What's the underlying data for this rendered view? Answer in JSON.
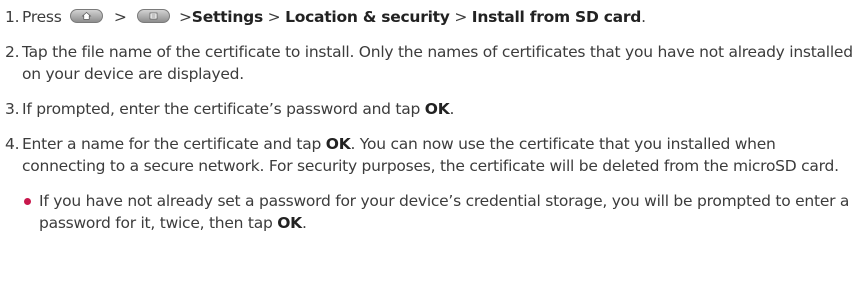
{
  "steps": [
    {
      "number": "1.",
      "press": "Press",
      "sep1": ">",
      "sep2": ">",
      "settings": "Settings",
      "sep3": ">",
      "location": "Location & security",
      "sep4": ">",
      "install": "Install from SD card",
      "end": "."
    },
    {
      "number": "2.",
      "text": "Tap the file name of the certificate to install. Only the names of certificates that you have not already installed on your device are displayed."
    },
    {
      "number": "3.",
      "text_a": "If prompted, enter the certificate’s password and tap ",
      "ok": "OK",
      "text_b": "."
    },
    {
      "number": "4.",
      "text_a": "Enter a name for the certificate and tap ",
      "ok": "OK",
      "text_b": ". You can now use the certificate that you installed when connecting to a secure network. For security purposes, the certificate will be deleted from the microSD card."
    }
  ],
  "bullet": {
    "text_a": "If you have not already set a password for your device’s credential storage, you will be prompted to enter a password for it, twice, then tap ",
    "ok": "OK",
    "text_b": "."
  },
  "icons": {
    "home_key": "home-key-icon",
    "menu_key": "menu-key-icon"
  },
  "colors": {
    "text": "#3c3c3c",
    "bullet": "#c8174c"
  }
}
